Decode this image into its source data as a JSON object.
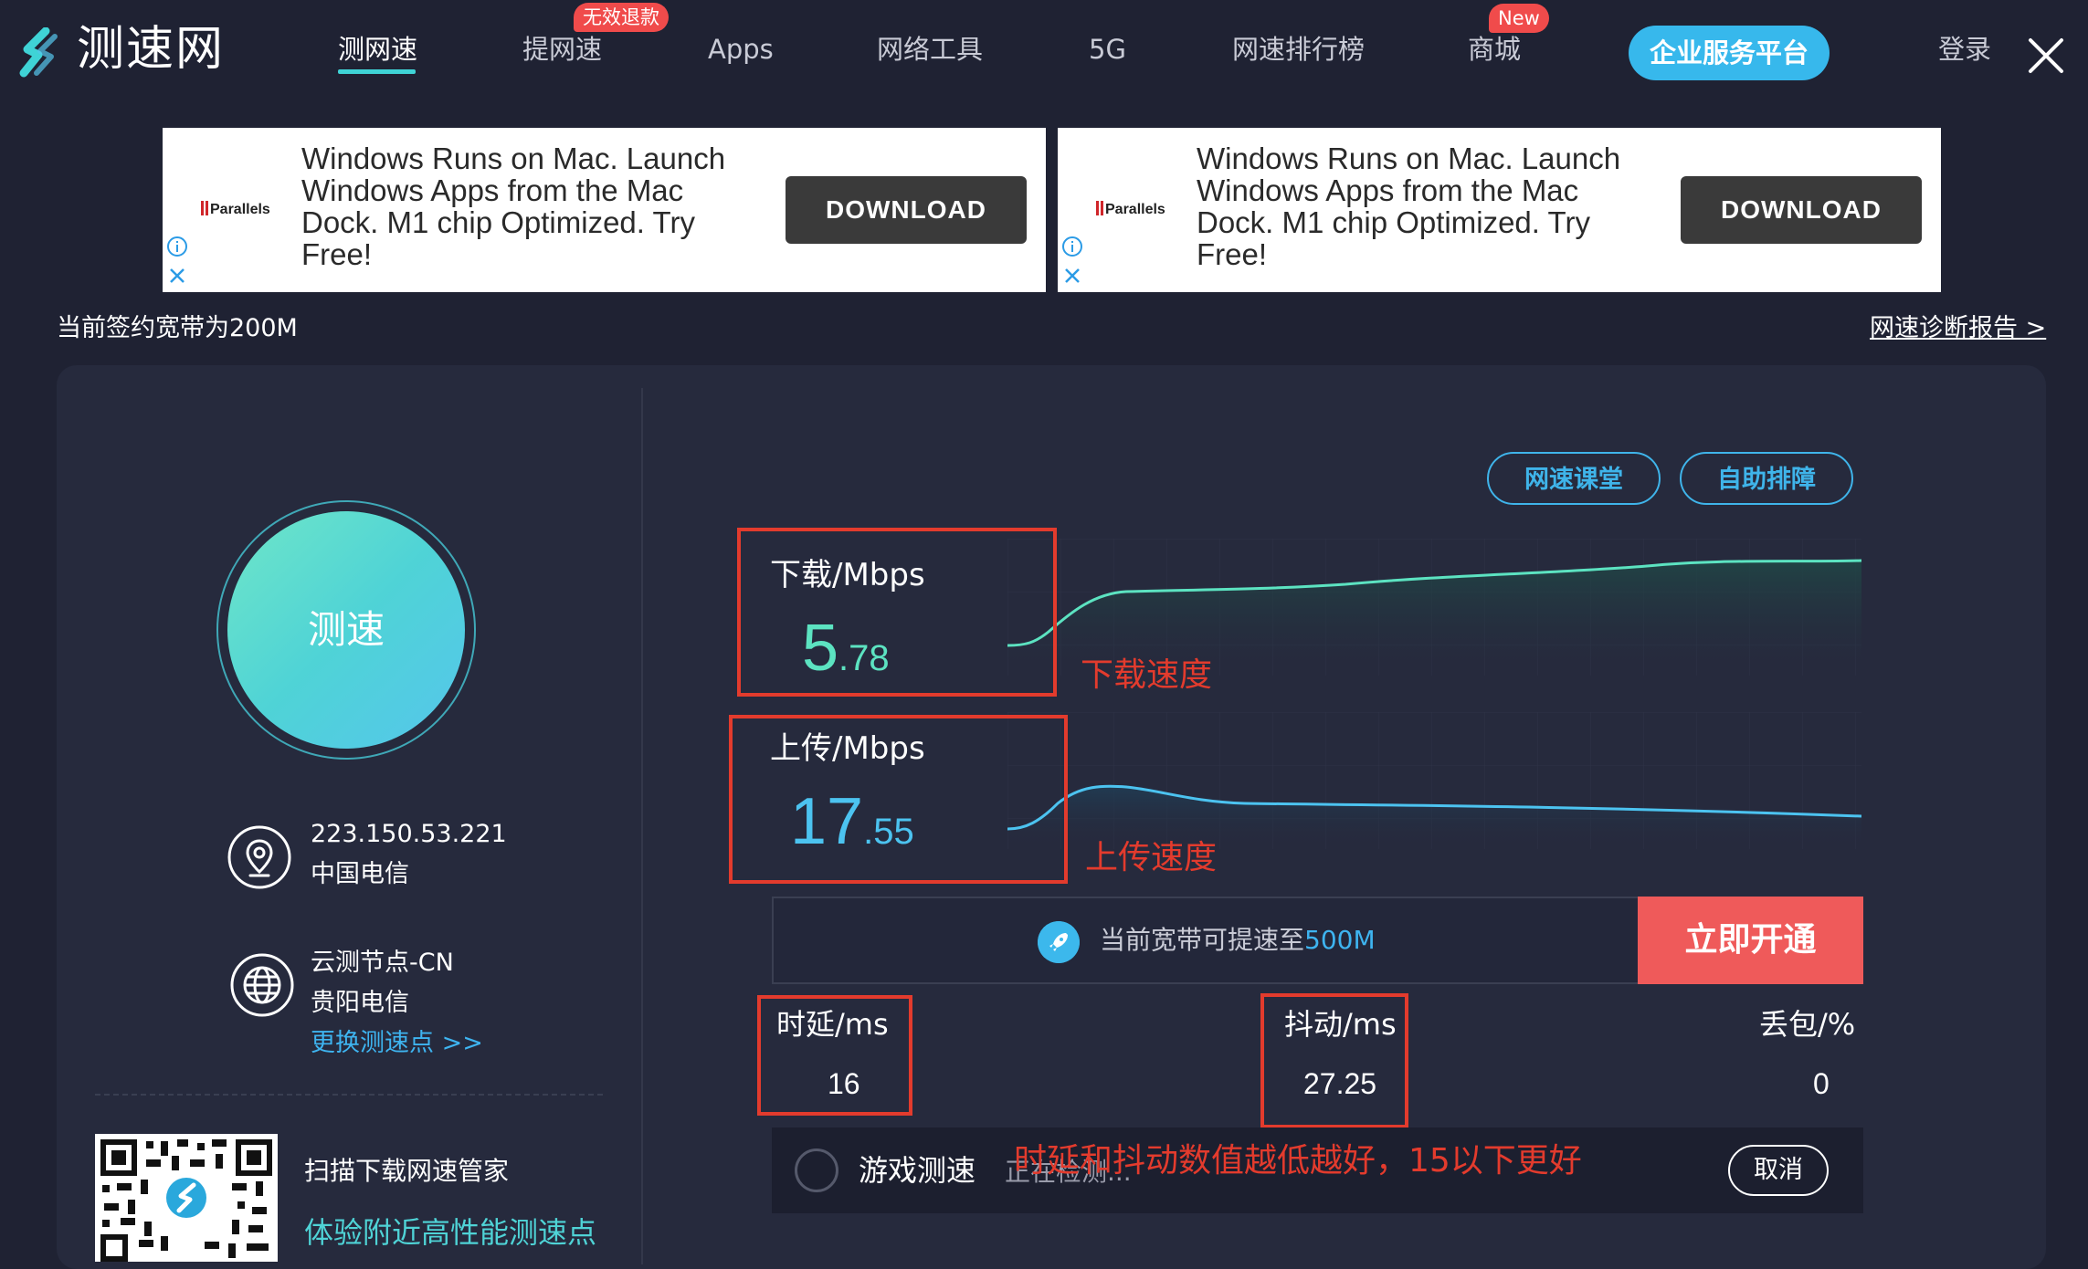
{
  "nav": {
    "logo_text": "测速网",
    "items": [
      "测网速",
      "提网速",
      "Apps",
      "网络工具",
      "5G",
      "网速排行榜",
      "商城"
    ],
    "badge_refund": "无效退款",
    "badge_new": "New",
    "enterprise_button": "企业服务平台",
    "login": "登录"
  },
  "ads": [
    {
      "brand": "Parallels",
      "copy": "Windows Runs on Mac. Launch Windows Apps from the Mac Dock. M1 chip Optimized. Try Free!",
      "button": "DOWNLOAD"
    },
    {
      "brand": "Parallels",
      "copy": "Windows Runs on Mac. Launch Windows Apps from the Mac Dock. M1 chip Optimized. Try Free!",
      "button": "DOWNLOAD"
    }
  ],
  "bandwidth_text": "当前签约宽带为200M",
  "report_link": "网速诊断报告 >",
  "start_button": "测速",
  "isp": {
    "ip": "223.150.53.221",
    "carrier": "中国电信"
  },
  "node": {
    "name": "云测节点-CN",
    "carrier": "贵阳电信",
    "switch_link": "更换测速点 >>"
  },
  "qr": {
    "title": "扫描下载网速管家",
    "subtitle": "体验附近高性能测速点"
  },
  "buttons": {
    "course": "网速课堂",
    "troubleshoot": "自助排障"
  },
  "download": {
    "label": "下载/Mbps",
    "int": "5",
    "dec": ".78",
    "note": "下载速度"
  },
  "upload": {
    "label": "上传/Mbps",
    "int": "17",
    "dec": ".55",
    "note": "上传速度"
  },
  "upgrade": {
    "prefix": "当前宽带可提速至",
    "highlight": "500M",
    "button": "立即开通"
  },
  "latency": {
    "label": "时延/ms",
    "value": "16"
  },
  "jitter": {
    "label": "抖动/ms",
    "value": "27.25"
  },
  "loss": {
    "label": "丢包/%",
    "value": "0"
  },
  "game": {
    "label": "游戏测速",
    "status": "正在检测...",
    "cancel": "取消"
  },
  "annotation": "时延和抖动数值越低越好，15以下更好",
  "colors": {
    "accent": "#3fd3d6",
    "link": "#3eb4f0",
    "danger": "#ef5a5a",
    "annotation": "#e33b2d",
    "download_line": "#5ce3c1",
    "upload_line": "#4cc3f0"
  }
}
